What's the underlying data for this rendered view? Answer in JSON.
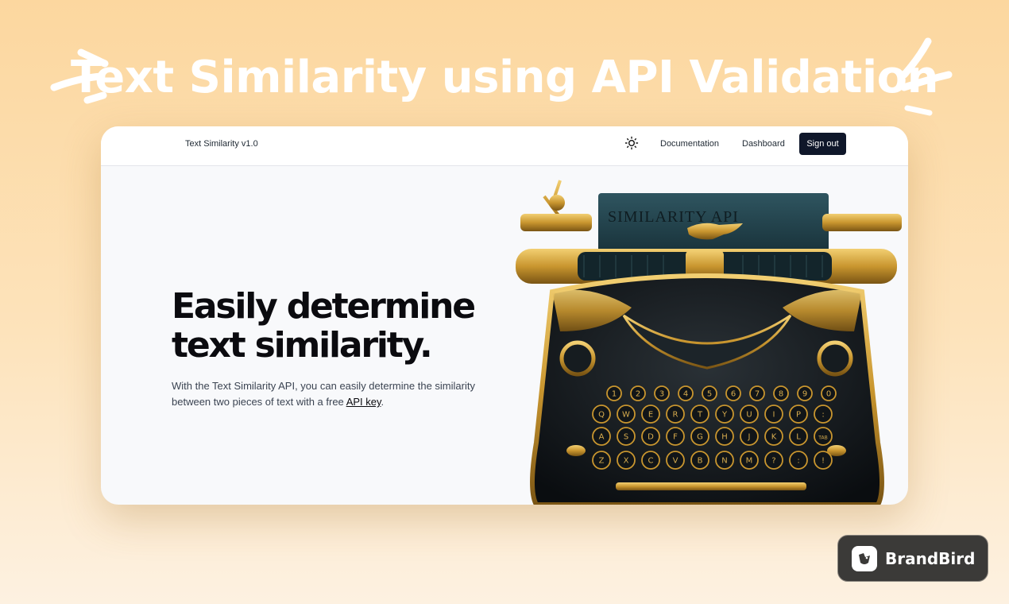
{
  "headline": "Text Similarity using API Validation",
  "nav": {
    "brand": "Text Similarity v1.0",
    "theme_icon": "sun-icon",
    "documentation": "Documentation",
    "dashboard": "Dashboard",
    "sign_out": "Sign out"
  },
  "hero": {
    "title_line1": "Easily determine",
    "title_line2": "text similarity.",
    "text_before_link": "With the Text Similarity API, you can easily determine the similarity between two pieces of text with a free ",
    "link": "API key",
    "text_after_link": "."
  },
  "typewriter": {
    "paper_text": "SIMILARITY API",
    "number_keys": [
      "1",
      "2",
      "3",
      "4",
      "5",
      "6",
      "7",
      "8",
      "9",
      "0"
    ],
    "row1_keys": [
      "Q",
      "W",
      "E",
      "R",
      "T",
      "Y",
      "U",
      "I",
      "P",
      ":"
    ],
    "row2_keys": [
      "A",
      "S",
      "D",
      "F",
      "G",
      "H",
      "J",
      "K",
      "L",
      "TAB"
    ],
    "row3_keys": [
      "Z",
      "X",
      "C",
      "V",
      "B",
      "N",
      "M",
      "?",
      ":",
      "!"
    ]
  },
  "watermark": {
    "icon": "brandbird-logo-icon",
    "label": "BrandBird"
  },
  "colors": {
    "background": "#fcd79f",
    "button": "#0f172a",
    "gold": "#c9962f"
  }
}
